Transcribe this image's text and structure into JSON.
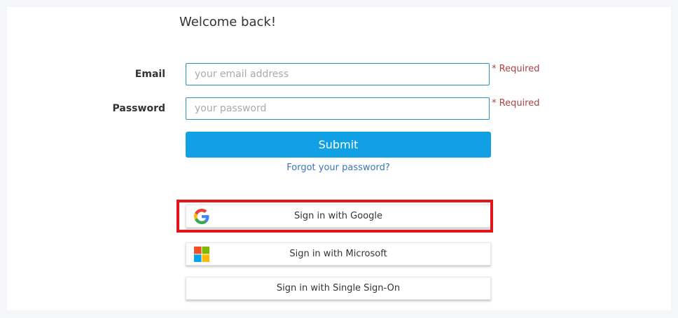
{
  "welcome": "Welcome back!",
  "form": {
    "email": {
      "label": "Email",
      "placeholder": "your email address",
      "required": "* Required"
    },
    "password": {
      "label": "Password",
      "placeholder": "your password",
      "required": "* Required"
    },
    "submit_label": "Submit",
    "forgot_label": "Forgot your password?"
  },
  "sso": {
    "google_label": "Sign in with Google",
    "microsoft_label": "Sign in with Microsoft",
    "single_sign_on_label": "Sign in with Single Sign-On"
  },
  "colors": {
    "accent": "#12a0e4",
    "link": "#3b73b9",
    "required": "#a94442",
    "highlight": "#e0161b"
  },
  "icons": {
    "google": "google-logo-icon",
    "microsoft": "microsoft-logo-icon"
  }
}
